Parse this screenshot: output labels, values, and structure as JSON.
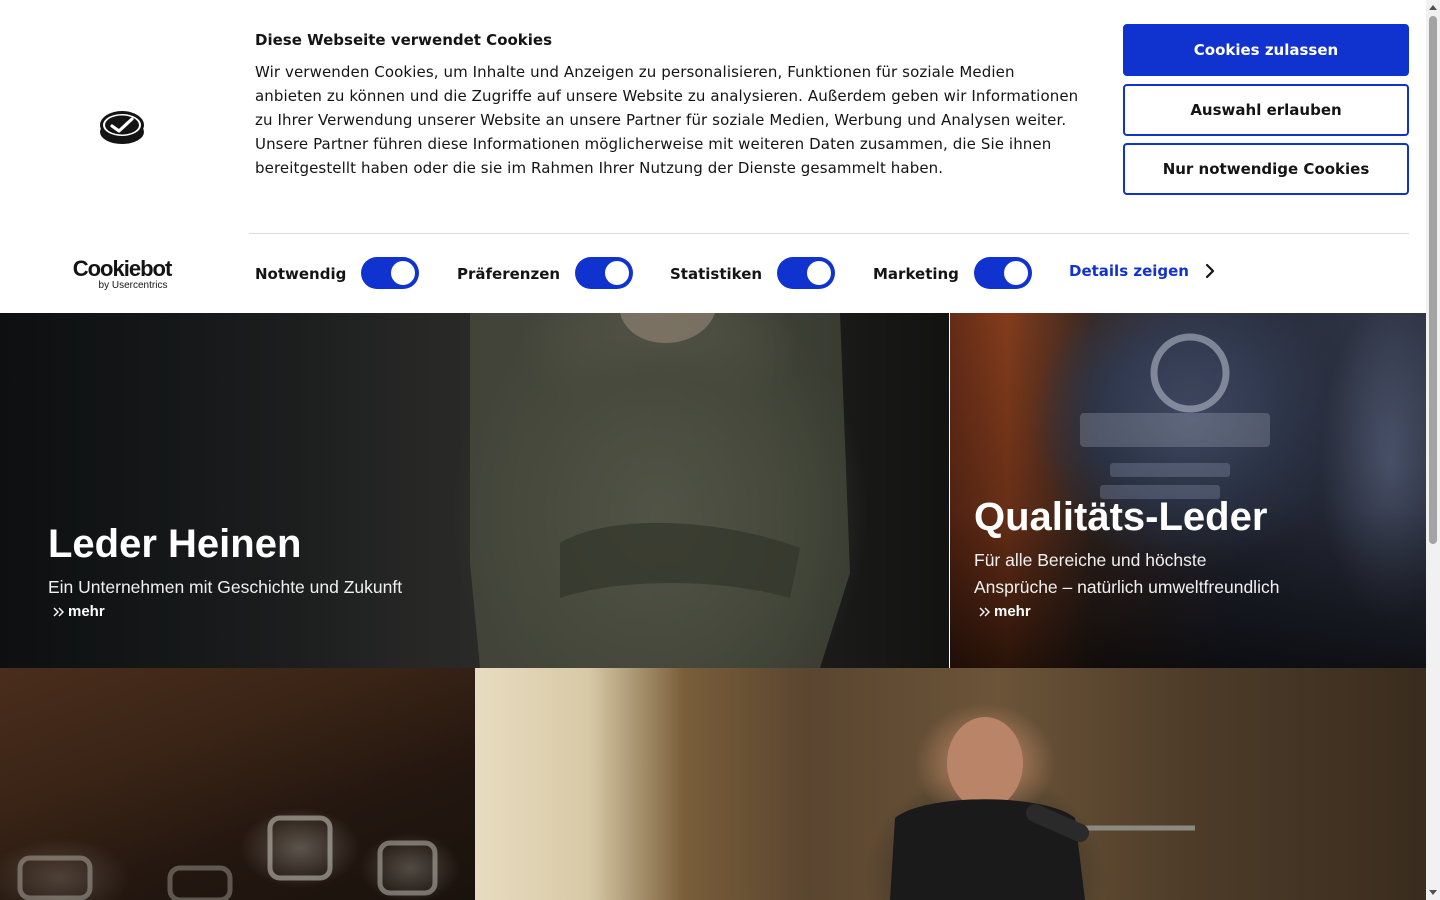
{
  "cookie_banner": {
    "title": "Diese Webseite verwendet Cookies",
    "text": "Wir verwenden Cookies, um Inhalte und Anzeigen zu personalisieren, Funktionen für soziale Medien anbieten zu können und die Zugriffe auf unsere Website zu analysieren. Außerdem geben wir Informationen zu Ihrer Verwendung unserer Website an unsere Partner für soziale Medien, Werbung und Analysen weiter. Unsere Partner führen diese Informationen möglicherweise mit weiteren Daten zusammen, die Sie ihnen bereitgestellt haben oder die sie im Rahmen Ihrer Nutzung der Dienste gesammelt haben.",
    "brand": {
      "name": "Cookiebot",
      "sub": "by Usercentrics"
    },
    "buttons": {
      "allow_all": "Cookies zulassen",
      "allow_selection": "Auswahl erlauben",
      "necessary_only": "Nur notwendige Cookies"
    },
    "consents": [
      {
        "label": "Notwendig",
        "enabled": true
      },
      {
        "label": "Präferenzen",
        "enabled": true
      },
      {
        "label": "Statistiken",
        "enabled": true
      },
      {
        "label": "Marketing",
        "enabled": true
      }
    ],
    "details_link": "Details zeigen",
    "accent_color": "#1032cf"
  },
  "tiles": {
    "heinen": {
      "title": "Leder Heinen",
      "subtitle": "Ein Unternehmen mit Geschichte und Zukunft",
      "more": "mehr"
    },
    "quality": {
      "title": "Qualitäts-Leder",
      "subtitle_line1": "Für alle Bereiche und höchste",
      "subtitle_line2": "Ansprüche – natürlich umweltfreundlich",
      "more": "mehr"
    }
  }
}
